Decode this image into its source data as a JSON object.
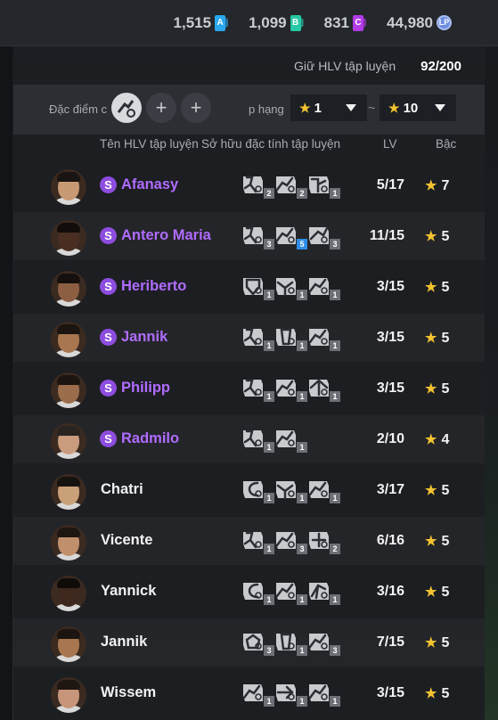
{
  "currencies": [
    {
      "value": "1,515",
      "badge": "A",
      "color": "#29a8ee"
    },
    {
      "value": "1,099",
      "badge": "B",
      "color": "#27c9a6"
    },
    {
      "value": "831",
      "badge": "C",
      "color": "#b23be6"
    },
    {
      "value": "44,980",
      "badge": "LP",
      "color": "#6e8fe0"
    }
  ],
  "keep": {
    "label": "Giữ HLV tập luyện",
    "value": "92/200"
  },
  "filter": {
    "trait_label": "Đặc điểm c",
    "add_symbol": "+",
    "rank_label": "p hạng",
    "rank_from": "1",
    "rank_to": "10",
    "tilde": "~",
    "star": "★"
  },
  "columns": {
    "name": "Tên HLV tập luyện",
    "traits": "Sở hữu đặc tính tập luyện",
    "lv": "LV",
    "grade": "Bậc"
  },
  "coaches": [
    {
      "name": "Afanasy",
      "special": true,
      "badge": "S",
      "traits": [
        {
          "icon": "kick-icon",
          "lvl": "2"
        },
        {
          "icon": "dribble-icon",
          "lvl": "2"
        },
        {
          "icon": "shot-icon",
          "lvl": "1"
        }
      ],
      "lv": "5/17",
      "grade": "7",
      "skin": "#c79a74",
      "hair": "#1a1412"
    },
    {
      "name": "Antero Maria",
      "special": true,
      "badge": "S",
      "traits": [
        {
          "icon": "kick-icon",
          "lvl": "3"
        },
        {
          "icon": "dribble-icon",
          "lvl": "5",
          "highlight": true
        },
        {
          "icon": "pass-icon",
          "lvl": "3"
        }
      ],
      "lv": "11/15",
      "grade": "5",
      "skin": "#4a2e22",
      "hair": "#120d0b"
    },
    {
      "name": "Heriberto",
      "special": true,
      "badge": "S",
      "traits": [
        {
          "icon": "shield-icon",
          "lvl": "1"
        },
        {
          "icon": "header-icon",
          "lvl": "1"
        },
        {
          "icon": "dribble-icon",
          "lvl": "1"
        }
      ],
      "lv": "3/15",
      "grade": "5",
      "skin": "#8c5f42",
      "hair": "#15100d"
    },
    {
      "name": "Jannik",
      "special": true,
      "badge": "S",
      "traits": [
        {
          "icon": "kick-icon",
          "lvl": "1"
        },
        {
          "icon": "strength-icon",
          "lvl": "1"
        },
        {
          "icon": "dribble-icon",
          "lvl": "1"
        }
      ],
      "lv": "3/15",
      "grade": "5",
      "skin": "#a8764f",
      "hair": "#1b1410"
    },
    {
      "name": "Philipp",
      "special": true,
      "badge": "S",
      "traits": [
        {
          "icon": "kick-icon",
          "lvl": "1"
        },
        {
          "icon": "dribble-icon",
          "lvl": "1"
        },
        {
          "icon": "defend-icon",
          "lvl": "1"
        }
      ],
      "lv": "3/15",
      "grade": "5",
      "skin": "#9c6d4b",
      "hair": "#1b1410"
    },
    {
      "name": "Radmilo",
      "special": true,
      "badge": "S",
      "traits": [
        {
          "icon": "kick-icon",
          "lvl": "1"
        },
        {
          "icon": "dribble-icon",
          "lvl": "1"
        }
      ],
      "lv": "2/10",
      "grade": "4",
      "skin": "#c99c7e",
      "hair": "#2a2420"
    },
    {
      "name": "Chatri",
      "special": false,
      "badge": "",
      "traits": [
        {
          "icon": "swerve-icon",
          "lvl": "1"
        },
        {
          "icon": "header-icon",
          "lvl": "1"
        },
        {
          "icon": "dribble-icon",
          "lvl": "1"
        }
      ],
      "lv": "3/17",
      "grade": "5",
      "skin": "#caa079",
      "hair": "#161210"
    },
    {
      "name": "Vicente",
      "special": false,
      "badge": "",
      "traits": [
        {
          "icon": "kick-icon",
          "lvl": "1"
        },
        {
          "icon": "dribble-icon",
          "lvl": "3"
        },
        {
          "icon": "keeper-icon",
          "lvl": "2"
        }
      ],
      "lv": "6/16",
      "grade": "5",
      "skin": "#c08f6c",
      "hair": "#1e1611"
    },
    {
      "name": "Yannick",
      "special": false,
      "badge": "",
      "traits": [
        {
          "icon": "swerve-icon",
          "lvl": "1"
        },
        {
          "icon": "dribble-icon",
          "lvl": "1"
        },
        {
          "icon": "tackle-icon",
          "lvl": "1"
        }
      ],
      "lv": "3/16",
      "grade": "5",
      "skin": "#3e271c",
      "hair": "#0f0b09"
    },
    {
      "name": "Jannik",
      "special": false,
      "badge": "",
      "traits": [
        {
          "icon": "ball-icon",
          "lvl": "3"
        },
        {
          "icon": "strength-icon",
          "lvl": "1"
        },
        {
          "icon": "dribble-icon",
          "lvl": "3"
        }
      ],
      "lv": "7/15",
      "grade": "5",
      "skin": "#a8764f",
      "hair": "#1b1410"
    },
    {
      "name": "Wissem",
      "special": false,
      "badge": "",
      "traits": [
        {
          "icon": "dribble-icon",
          "lvl": "1"
        },
        {
          "icon": "speed-icon",
          "lvl": "1"
        },
        {
          "icon": "dribble-icon",
          "lvl": "1"
        }
      ],
      "lv": "3/15",
      "grade": "5",
      "skin": "#c7957a",
      "hair": "#1e1611"
    }
  ]
}
